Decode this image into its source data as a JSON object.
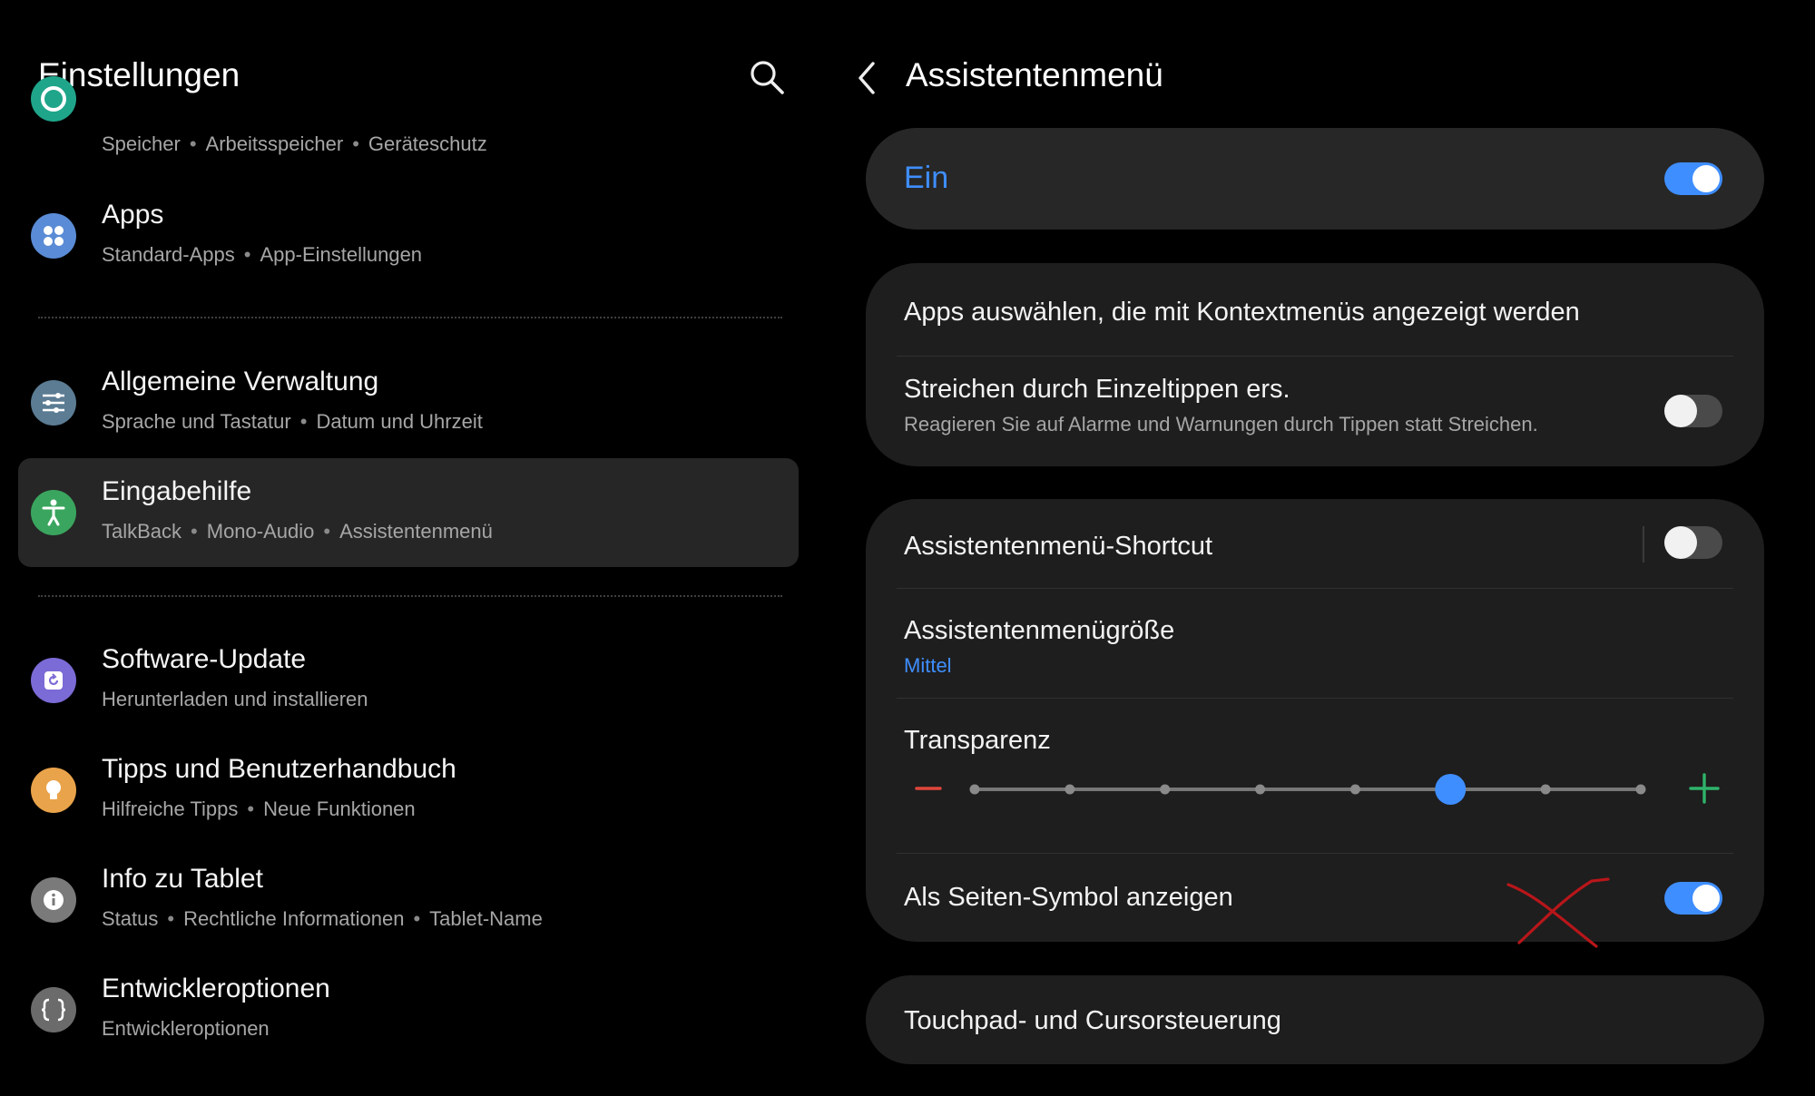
{
  "left": {
    "title": "Einstellungen",
    "items": [
      {
        "id": "storage",
        "subs": [
          "Speicher",
          "Arbeitsspeicher",
          "Geräteschutz"
        ],
        "icon": "device-care-icon",
        "color": "#1fa58a"
      },
      {
        "id": "apps",
        "title": "Apps",
        "subs": [
          "Standard-Apps",
          "App-Einstellungen"
        ],
        "icon": "apps-icon",
        "color": "#5a8bd6"
      },
      {
        "id": "general",
        "title": "Allgemeine Verwaltung",
        "subs": [
          "Sprache und Tastatur",
          "Datum und Uhrzeit"
        ],
        "icon": "sliders-icon",
        "color": "#5b7c93"
      },
      {
        "id": "accessibility",
        "title": "Eingabehilfe",
        "subs": [
          "TalkBack",
          "Mono-Audio",
          "Assistentenmenü"
        ],
        "icon": "accessibility-icon",
        "color": "#3aa55e",
        "selected": true
      },
      {
        "id": "update",
        "title": "Software-Update",
        "subs": [
          "Herunterladen und installieren"
        ],
        "icon": "software-update-icon",
        "color": "#7b6bd6"
      },
      {
        "id": "tips",
        "title": "Tipps und Benutzerhandbuch",
        "subs": [
          "Hilfreiche Tipps",
          "Neue Funktionen"
        ],
        "icon": "lightbulb-icon",
        "color": "#e9a34a"
      },
      {
        "id": "about",
        "title": "Info zu Tablet",
        "subs": [
          "Status",
          "Rechtliche Informationen",
          "Tablet-Name"
        ],
        "icon": "info-icon",
        "color": "#7a7a7a"
      },
      {
        "id": "dev",
        "title": "Entwickleroptionen",
        "subs": [
          "Entwickleroptionen"
        ],
        "icon": "braces-icon",
        "color": "#6b6b6b"
      }
    ]
  },
  "right": {
    "title": "Assistentenmenü",
    "master": {
      "label": "Ein",
      "on": true
    },
    "apps_select": "Apps auswählen, die mit Kontextmenüs angezeigt werden",
    "swipe": {
      "title": "Streichen durch Einzeltippen ers.",
      "subtitle": "Reagieren Sie auf Alarme und Warnungen durch Tippen statt Streichen.",
      "on": false
    },
    "shortcut": {
      "title": "Assistentenmenü-Shortcut",
      "on": false
    },
    "size": {
      "title": "Assistentenmenügröße",
      "value": "Mittel"
    },
    "transparency": {
      "title": "Transparenz",
      "steps": 8,
      "level": 0.7143
    },
    "side_icon": {
      "title": "Als Seiten-Symbol anzeigen",
      "on": true
    },
    "touchpad": "Touchpad- und Cursorsteuerung"
  },
  "colors": {
    "accent": "#3f8eff",
    "minus": "#e0463c",
    "plus": "#2fb36a",
    "annotation": "#c0181c"
  }
}
